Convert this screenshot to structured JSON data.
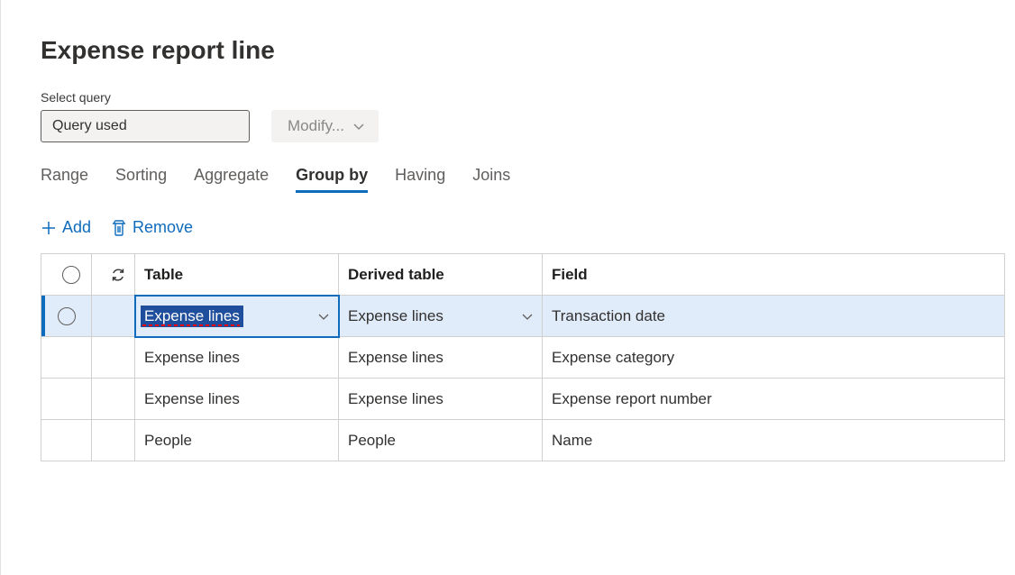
{
  "title": "Expense report line",
  "selectQuery": {
    "label": "Select query",
    "value": "Query used",
    "modifyLabel": "Modify..."
  },
  "tabs": [
    "Range",
    "Sorting",
    "Aggregate",
    "Group by",
    "Having",
    "Joins"
  ],
  "activeTab": "Group by",
  "actions": {
    "add": "Add",
    "remove": "Remove"
  },
  "columns": {
    "table": "Table",
    "derived": "Derived table",
    "field": "Field"
  },
  "rows": [
    {
      "table": "Expense lines",
      "derived": "Expense lines",
      "field": "Transaction date",
      "selected": true,
      "editing": true
    },
    {
      "table": "Expense lines",
      "derived": "Expense lines",
      "field": "Expense category",
      "selected": false,
      "editing": false
    },
    {
      "table": "Expense lines",
      "derived": "Expense lines",
      "field": "Expense report number",
      "selected": false,
      "editing": false
    },
    {
      "table": "People",
      "derived": "People",
      "field": "Name",
      "selected": false,
      "editing": false
    }
  ]
}
